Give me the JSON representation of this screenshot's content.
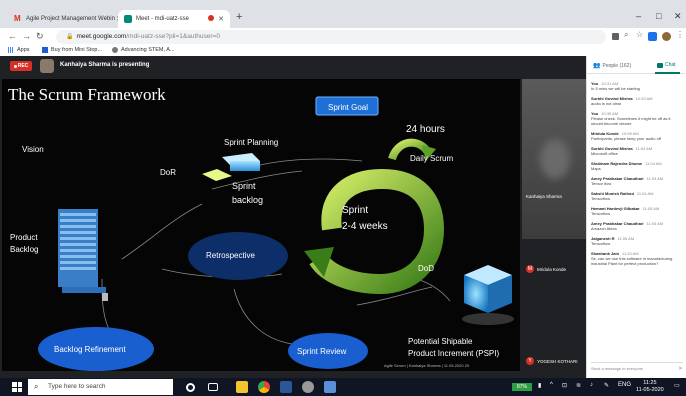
{
  "browser": {
    "tabs": [
      {
        "label": "Agile Project Management Webin",
        "icon": "gmail-icon"
      },
      {
        "label": "Meet - mdi-uatz-sse",
        "icon": "meet-icon"
      }
    ],
    "new_tab": "+",
    "window_controls": {
      "minimize": "–",
      "maximize": "□",
      "close": "✕"
    },
    "url_host": "meet.google.com",
    "url_path": "/mdi-uatz-sse?pli=1&authuser=0",
    "bookmarks": [
      "Apps",
      "Buy from Mini Stop...",
      "Advancing STEM, A..."
    ]
  },
  "meet": {
    "rec_label": "REC",
    "presenter": "Kanhaiya Sharma is presenting",
    "slide": {
      "title": "The Scrum Framework",
      "labels": {
        "sprint_goal": "Sprint Goal",
        "hours": "24 hours",
        "daily_scrum": "Daily Scrum",
        "sprint_planning": "Sprint Planning",
        "vision": "Vision",
        "dor": "DoR",
        "sprint_backlog_1": "Sprint",
        "sprint_backlog_2": "backlog",
        "sprint_1": "Sprint",
        "sprint_2": "2-4 weeks",
        "product_backlog_1": "Product",
        "product_backlog_2": "Backlog",
        "retrospective": "Retrospective",
        "dod": "DoD",
        "backlog_refinement": "Backlog Refinement",
        "sprint_review": "Sprint Review",
        "pspi_1": "Potential Shipable",
        "pspi_2": "Product Increment (PSPI)"
      },
      "footer": "Agile Scrum | Kanhaiya Sharma | 11.05.2020     29"
    },
    "participants": [
      {
        "name": "Kanhaiya Sharma",
        "avatar": ""
      },
      {
        "name": "Mridula Konde",
        "avatar": "M"
      },
      {
        "name": "YOGESH KOTHARI",
        "avatar": "Y"
      }
    ]
  },
  "panel": {
    "people_tab": "People (162)",
    "chat_tab": "Chat",
    "messages": [
      {
        "sender": "You",
        "time": "10:31 AM",
        "text": "In 5 mins we will be starting"
      },
      {
        "sender": "Surbhi Govind Mishra",
        "time": "10:33 AM",
        "text": "audio is not clear"
      },
      {
        "sender": "You",
        "time": "10:35 AM",
        "text": "Please check. Sometimes it might be off as it should become clearer"
      },
      {
        "sender": "Mridula Konde",
        "time": "10:59 AM",
        "text": "Participants, please keep your audio off"
      },
      {
        "sender": "Surbhi Govind Mishra",
        "time": "11:04 AM",
        "text": "Microsoft office"
      },
      {
        "sender": "Shubham Rajendra Dhume",
        "time": "11:04 AM",
        "text": "Maps"
      },
      {
        "sender": "Amey Prabhakar Chaudhari",
        "time": "11:04 AM",
        "text": "Tensor flow"
      },
      {
        "sender": "Sakshi Munish Rathod",
        "time": "11:04 AM",
        "text": "Tensorflow"
      },
      {
        "sender": "Hemant Hardevji Gilbakar",
        "time": "11:05 AM",
        "text": "Tensorflow"
      },
      {
        "sender": "Amey Prabhakar Chaudhari",
        "time": "11:05 AM",
        "text": "Amazon Alexa"
      },
      {
        "sender": "Jaiganesh R",
        "time": "11:05 AM",
        "text": "Tensorflow"
      },
      {
        "sender": "Shashank Jain",
        "time": "11:20 AM",
        "text": "Sir, can we use this software in manufacturing industrial Plant for perfect production?"
      }
    ],
    "send_placeholder": "Send a message to everyone"
  },
  "taskbar": {
    "search_placeholder": "Type here to search",
    "battery": "87%",
    "lang": "ENG",
    "time": "11:25",
    "date": "11-05-2020"
  },
  "colors": {
    "meet_bg": "#202124",
    "rec_red": "#d93025",
    "chat_accent": "#00796b",
    "sprint_goal_blue": "#1e6fd6",
    "oval_navy": "#0e2e6a",
    "oval_blue": "#1a5fd0",
    "sprint_green": "#5da12a"
  }
}
